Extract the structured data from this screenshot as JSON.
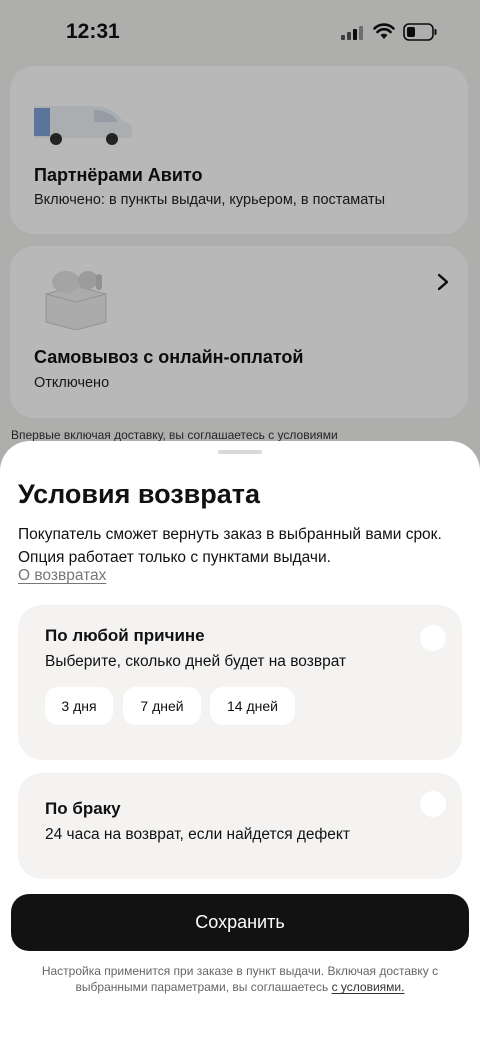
{
  "status_bar": {
    "time": "12:31"
  },
  "background": {
    "partners_card": {
      "title": "Партнёрами Авито",
      "subtitle": "Включено: в пункты выдачи, курьером, в постаматы"
    },
    "pickup_card": {
      "title": "Самовывоз с онлайн-оплатой",
      "subtitle": "Отключено"
    },
    "note": "Впервые включая доставку, вы соглашаетесь с условиями"
  },
  "sheet": {
    "title": "Условия возврата",
    "description": "Покупатель сможет вернуть заказ в выбранный вами срок. Опция работает только с пунктами выдачи.",
    "link": "О возвратах",
    "options": [
      {
        "title": "По любой причине",
        "subtitle": "Выберите, сколько дней будет на возврат",
        "chips": [
          "3 дня",
          "7 дней",
          "14 дней"
        ]
      },
      {
        "title": "По браку",
        "subtitle": "24 часа на возврат, если найдется дефект"
      }
    ],
    "save_label": "Сохранить",
    "footer_text": "Настройка применится при заказе в пункт выдачи. Включая доставку с выбранными параметрами, вы соглашаетесь",
    "footer_link": "с условиями."
  },
  "colors": {
    "primary_button": "#121212",
    "option_bg": "#f4f3f2",
    "overlay": "rgba(0,0,0,0.28)"
  }
}
